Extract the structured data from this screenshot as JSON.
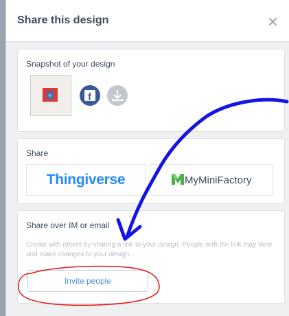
{
  "dialog": {
    "title": "Share this design",
    "close_icon": "close-icon"
  },
  "snapshot": {
    "label": "Snapshot of your design",
    "icons": [
      "facebook-icon",
      "download-icon"
    ],
    "facebook_glyph": "f"
  },
  "share": {
    "label": "Share",
    "platforms": [
      "Thingiverse",
      "MyMiniFactory"
    ]
  },
  "im": {
    "label": "Share over IM or email",
    "description": "Create with others by sharing a link to your design. People with the link may view and make changes to your design.",
    "invite_label": "Invite people"
  },
  "colors": {
    "thingiverse_blue": "#248bfb",
    "facebook_blue": "#3b5998",
    "annotation_arrow": "#1414e6",
    "annotation_circle": "#e01414",
    "mmf_green": "#4caf50"
  }
}
